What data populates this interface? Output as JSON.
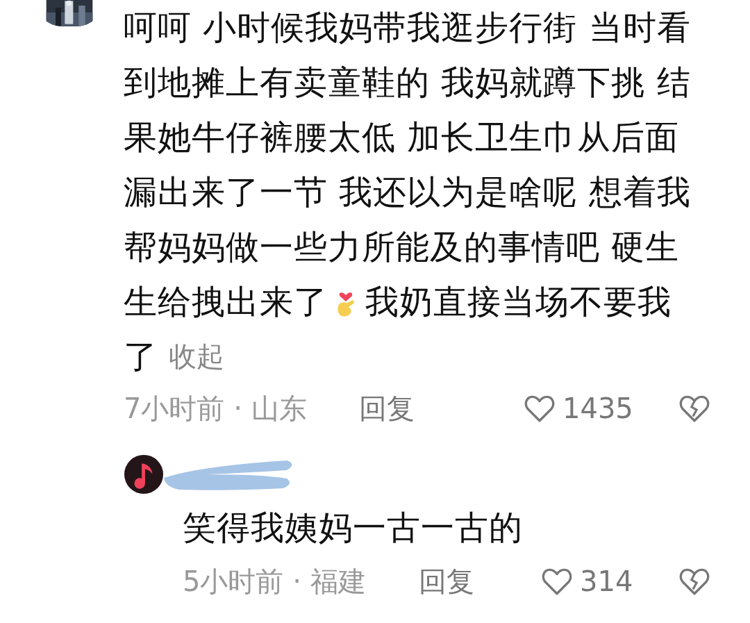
{
  "comments": [
    {
      "kind": "comment",
      "avatar": {
        "kind": "picture"
      },
      "lines": [
        [
          {
            "kind": "text",
            "text": "呵呵 小时候我妈带我逛步行街 当时看"
          }
        ],
        [
          {
            "kind": "text",
            "text": "到地摊上有卖童鞋的 我妈就蹲下挑 结"
          }
        ],
        [
          {
            "kind": "text",
            "text": "果她牛仔裤腰太低 加长卫生巾从后面"
          }
        ],
        [
          {
            "kind": "text",
            "text": "漏出来了一节 我还以为是啥呢 想着我"
          }
        ],
        [
          {
            "kind": "text",
            "text": "帮妈妈做一些力所能及的事情吧 硬生"
          }
        ],
        [
          {
            "kind": "text",
            "text": "生给拽出来了"
          },
          {
            "kind": "emoji"
          },
          {
            "kind": "text",
            "text": "我奶直接当场不要我"
          }
        ],
        [
          {
            "kind": "text",
            "text": "了"
          }
        ]
      ],
      "collapse_link": "收起",
      "time_location": "7小时前 · 山东",
      "reply_label": "回复",
      "likes": "1435"
    },
    {
      "kind": "reply",
      "avatar": {
        "kind": "music-note"
      },
      "lines": [
        [
          {
            "kind": "text",
            "text": "笑得我姨妈一古一古的"
          }
        ]
      ],
      "time_location": "5小时前 · 福建",
      "reply_label": "回复",
      "likes": "314"
    }
  ]
}
